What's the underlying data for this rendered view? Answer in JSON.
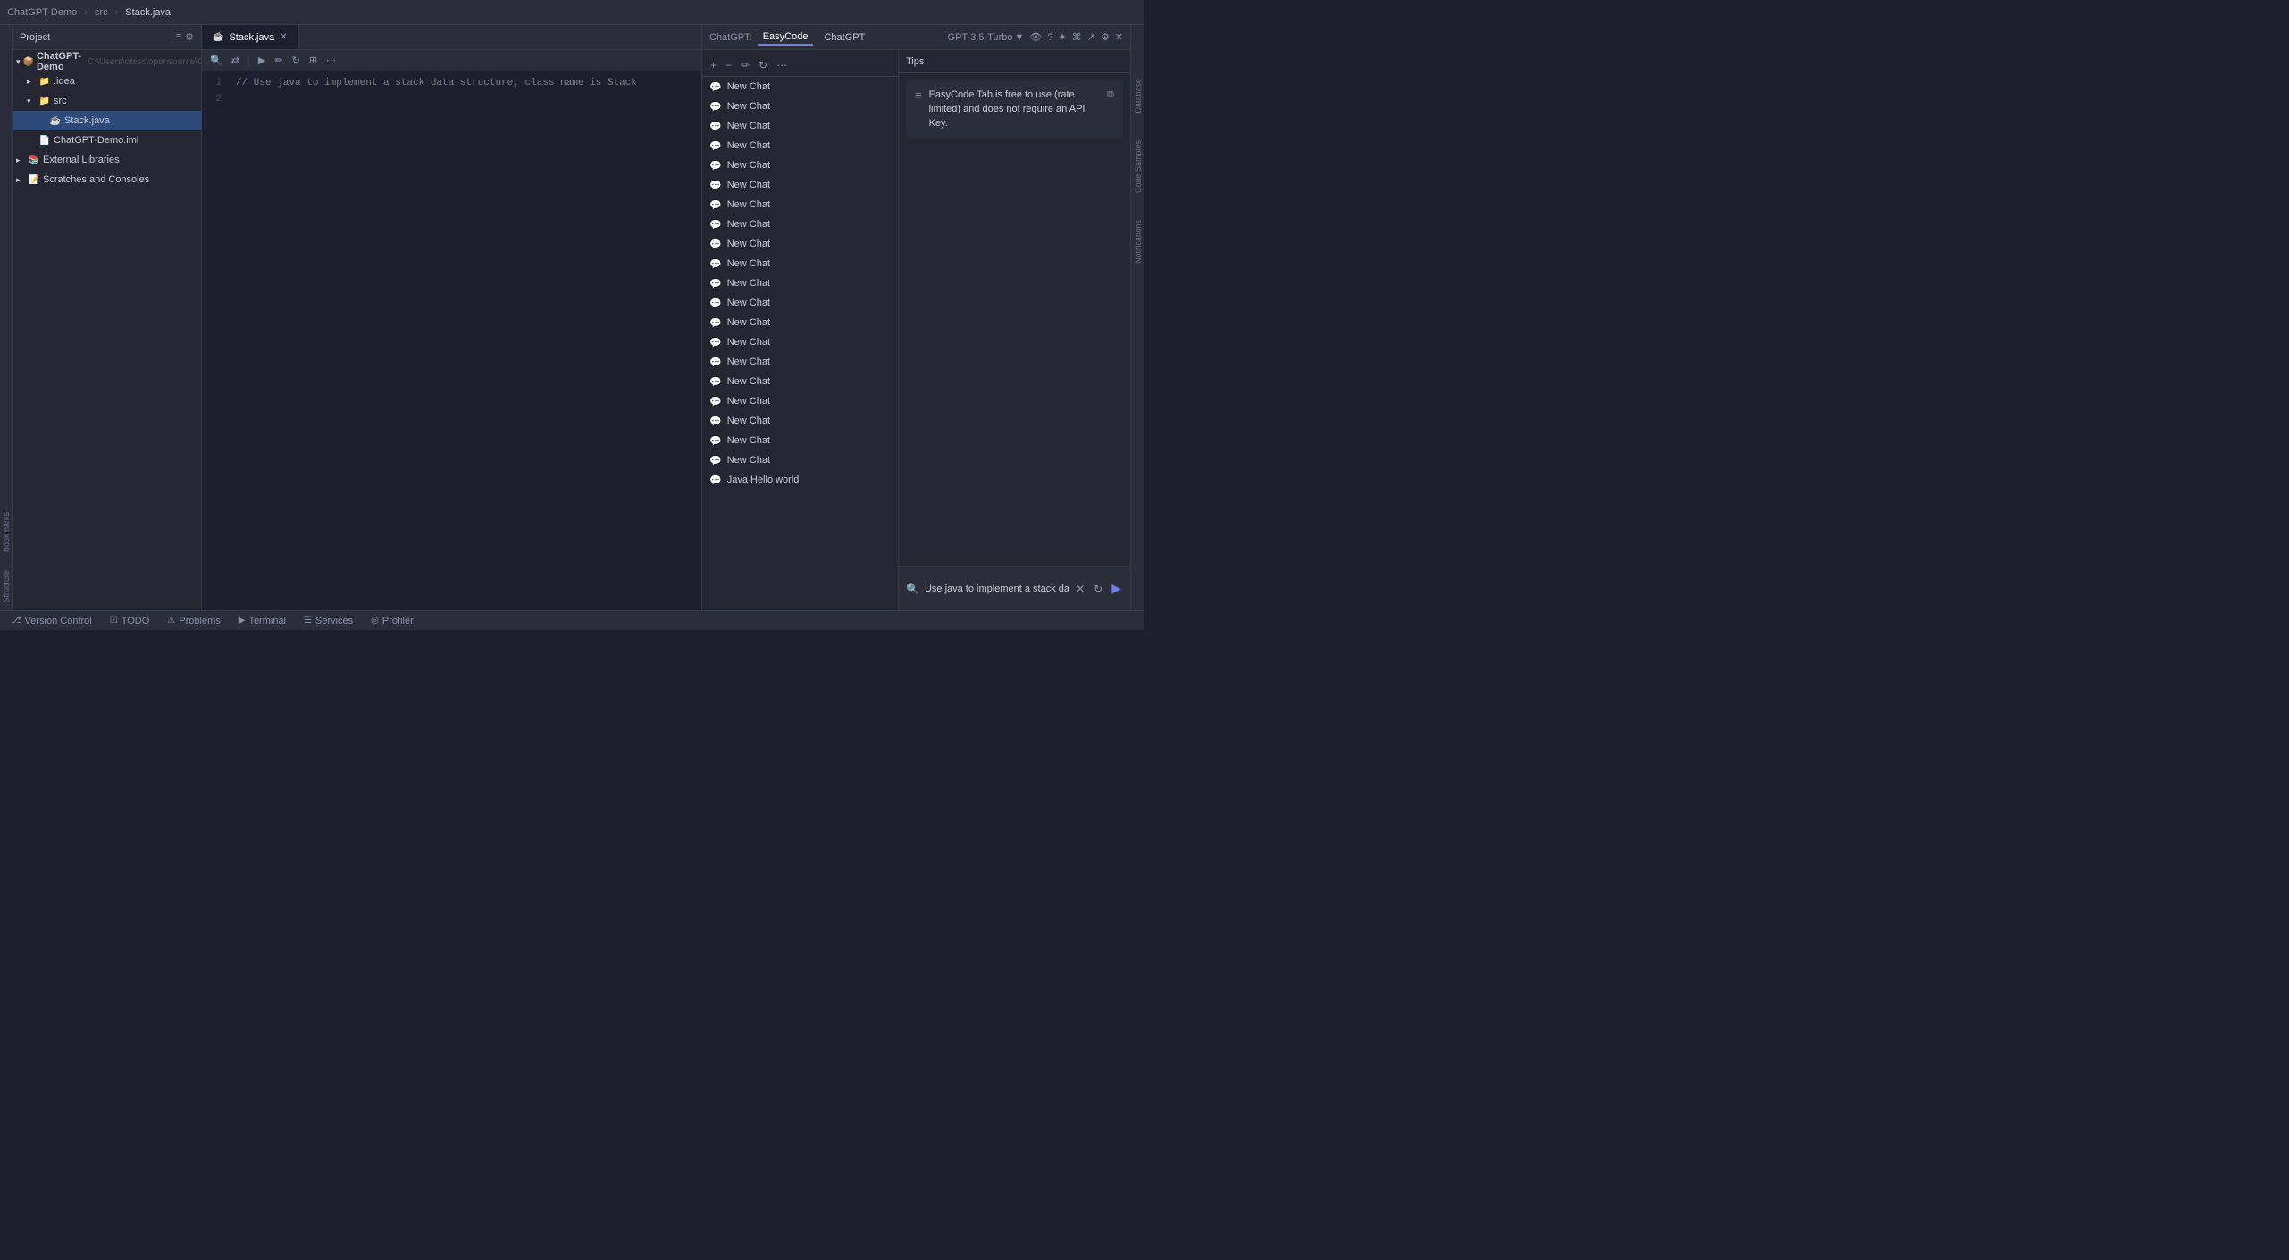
{
  "titleBar": {
    "appName": "ChatGPT-Demo",
    "separator1": "›",
    "folder": "src",
    "separator2": "›",
    "file": "Stack.java"
  },
  "projectPanel": {
    "title": "Project",
    "items": [
      {
        "id": "chatgpt-demo-root",
        "label": "ChatGPT-Demo",
        "path": "C:\\Users\\obisc\\opensource\\ChatGP",
        "indent": 0,
        "type": "module",
        "expanded": true
      },
      {
        "id": "idea-folder",
        "label": ".idea",
        "indent": 1,
        "type": "folder",
        "expanded": false
      },
      {
        "id": "src-folder",
        "label": "src",
        "indent": 1,
        "type": "folder",
        "expanded": true
      },
      {
        "id": "stack-java",
        "label": "Stack.java",
        "indent": 2,
        "type": "java",
        "selected": true
      },
      {
        "id": "chatgpt-demo-iml",
        "label": "ChatGPT-Demo.iml",
        "indent": 1,
        "type": "iml"
      },
      {
        "id": "external-libraries",
        "label": "External Libraries",
        "indent": 0,
        "type": "libraries",
        "expanded": false
      },
      {
        "id": "scratches",
        "label": "Scratches and Consoles",
        "indent": 0,
        "type": "scratches",
        "expanded": false
      }
    ]
  },
  "editor": {
    "tabs": [
      {
        "id": "stack-java-tab",
        "label": "Stack.java",
        "active": true,
        "icon": "java"
      }
    ],
    "code": [
      {
        "line": 1,
        "content": "// Use java to implement a stack data structure, class name is Stack"
      },
      {
        "line": 2,
        "content": ""
      }
    ]
  },
  "chatgpt": {
    "label": "ChatGPT:",
    "tabs": [
      {
        "id": "easycode-tab",
        "label": "EasyCode",
        "active": true
      },
      {
        "id": "chatgpt-tab",
        "label": "ChatGPT",
        "active": false
      }
    ],
    "model": {
      "name": "GPT-3.5-Turbo",
      "chevron": "▼"
    },
    "toolbar": {
      "addBtn": "+",
      "minusBtn": "−",
      "editBtn": "✏",
      "refreshBtn": "↻",
      "moreBtn": "⋯"
    },
    "chatItems": [
      {
        "id": "chat-1",
        "label": "New Chat"
      },
      {
        "id": "chat-2",
        "label": "New Chat"
      },
      {
        "id": "chat-3",
        "label": "New Chat"
      },
      {
        "id": "chat-4",
        "label": "New Chat"
      },
      {
        "id": "chat-5",
        "label": "New Chat"
      },
      {
        "id": "chat-6",
        "label": "New Chat"
      },
      {
        "id": "chat-7",
        "label": "New Chat"
      },
      {
        "id": "chat-8",
        "label": "New Chat"
      },
      {
        "id": "chat-9",
        "label": "New Chat"
      },
      {
        "id": "chat-10",
        "label": "New Chat"
      },
      {
        "id": "chat-11",
        "label": "New Chat"
      },
      {
        "id": "chat-12",
        "label": "New Chat"
      },
      {
        "id": "chat-13",
        "label": "New Chat"
      },
      {
        "id": "chat-14",
        "label": "New Chat"
      },
      {
        "id": "chat-15",
        "label": "New Chat"
      },
      {
        "id": "chat-16",
        "label": "New Chat"
      },
      {
        "id": "chat-17",
        "label": "New Chat"
      },
      {
        "id": "chat-18",
        "label": "New Chat"
      },
      {
        "id": "chat-19",
        "label": "New Chat"
      },
      {
        "id": "chat-20",
        "label": "New Chat"
      },
      {
        "id": "chat-21",
        "label": "Java Hello world"
      }
    ],
    "tips": {
      "header": "Tips",
      "message": "EasyCode Tab is free to use (rate limited) and does not require an API Key."
    },
    "input": {
      "value": "Use java to implement a stack data structure, class name is Stack",
      "clearBtn": "✕",
      "refreshBtn": "↻",
      "sendBtn": "▶"
    }
  },
  "rightSidebar": {
    "items": [
      {
        "id": "database-label",
        "label": "Database"
      },
      {
        "id": "code-samples-label",
        "label": "Code Samples"
      },
      {
        "id": "notifications-label",
        "label": "Notifications"
      }
    ]
  },
  "leftSidebar": {
    "bookmarks": "Bookmarks",
    "structure": "Structure"
  },
  "bottomBar": {
    "tabs": [
      {
        "id": "version-control",
        "label": "Version Control",
        "icon": "⎇"
      },
      {
        "id": "todo",
        "label": "TODO",
        "icon": "☑"
      },
      {
        "id": "problems",
        "label": "Problems",
        "icon": "⚠"
      },
      {
        "id": "terminal",
        "label": "Terminal",
        "icon": ">"
      },
      {
        "id": "services",
        "label": "Services",
        "icon": "☰"
      },
      {
        "id": "profiler",
        "label": "Profiler",
        "icon": "◎"
      }
    ]
  }
}
